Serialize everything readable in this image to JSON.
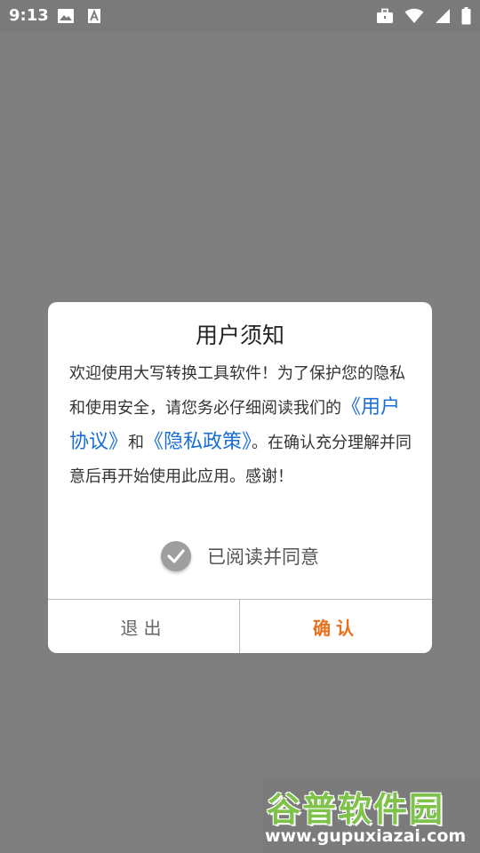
{
  "status_bar": {
    "time": "9:13",
    "left_icons": [
      "image-icon",
      "text-icon"
    ],
    "right_icons": [
      "briefcase-icon",
      "wifi-icon",
      "signal-icon",
      "battery-icon"
    ]
  },
  "dialog": {
    "title": "用户须知",
    "body_part1": "欢迎使用大写转换工具软件！为了保护您的隐私和使用安全，请您务必仔细阅读我们的",
    "user_agreement_link": "《用户协议》",
    "and_word": "和",
    "privacy_policy_link": "《隐私政策》",
    "body_part2": "。在确认充分理解并同意后再开始使用此应用。感谢！",
    "agree_label": "已阅读并同意",
    "agree_checked": true,
    "exit_label": "退出",
    "confirm_label": "确认"
  },
  "watermark": {
    "name": "谷普软件园",
    "url": "www.gupuxiazai.com"
  },
  "colors": {
    "overlay": "#7f7f7f",
    "link": "#1a6fd6",
    "confirm": "#e8711e",
    "watermark_green": "#7ec24a"
  }
}
